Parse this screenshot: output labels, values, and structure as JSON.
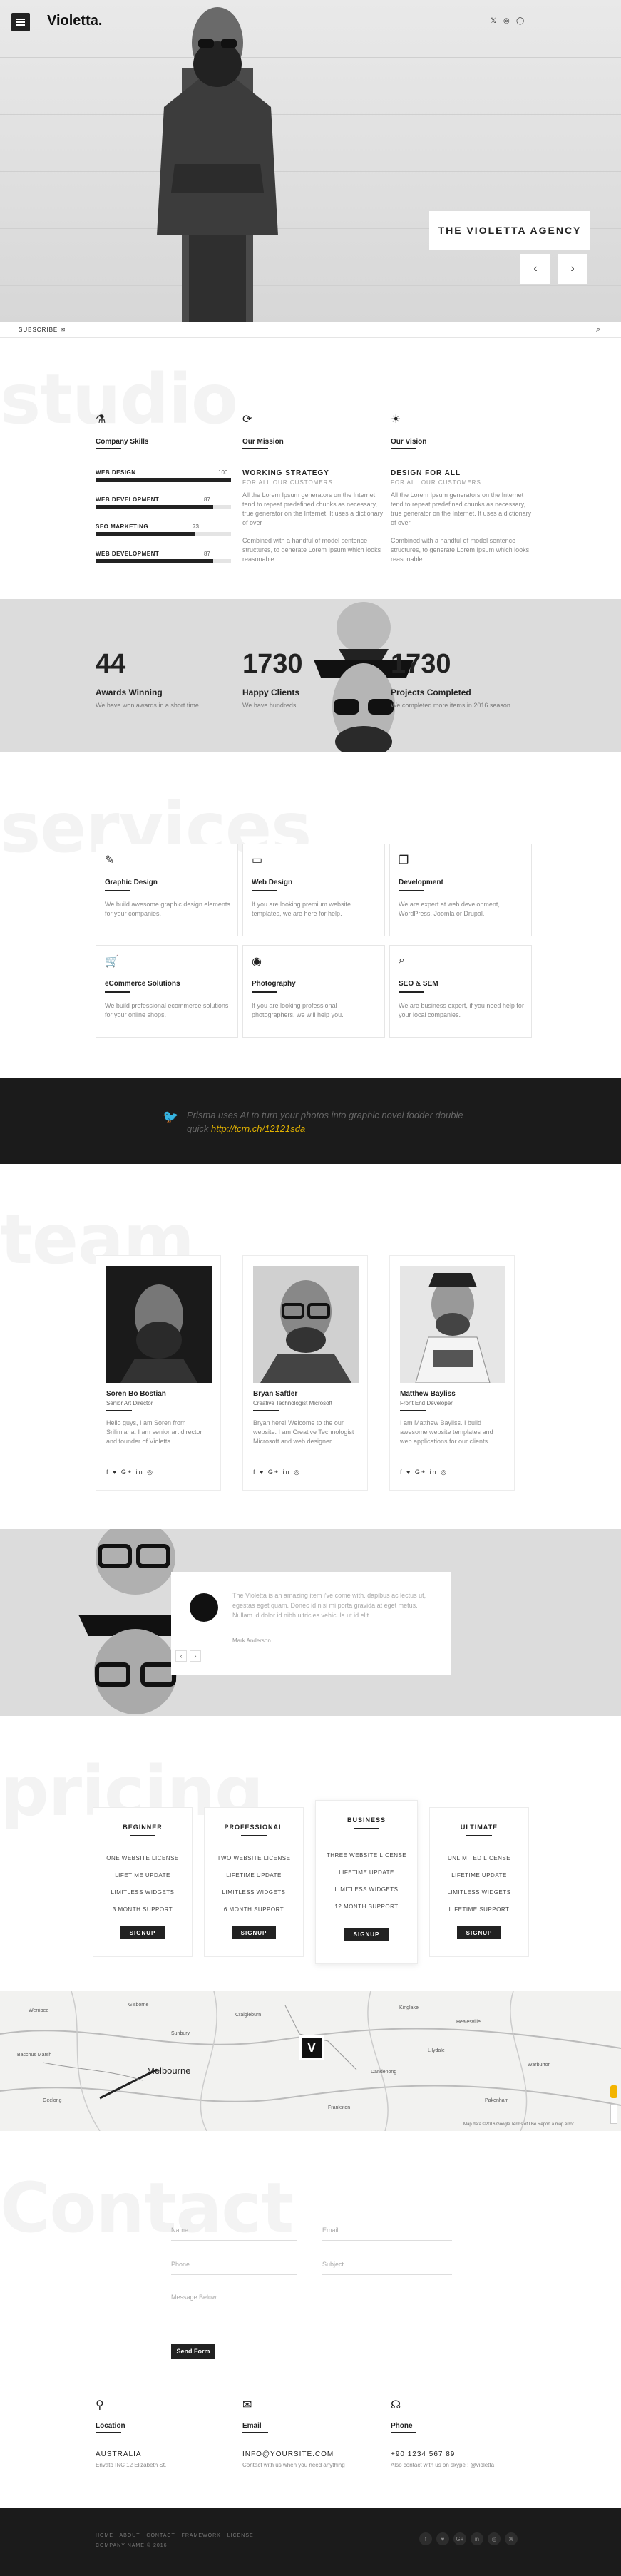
{
  "header": {
    "logo": "Violetta.",
    "social": [
      "𝕏",
      "◎",
      "◯"
    ]
  },
  "hero": {
    "agency": "THE VIOLETTA AGENCY",
    "prev": "‹",
    "next": "›"
  },
  "subscribe": {
    "label": "SUBSCRIBE ✉",
    "search_icon": "search-icon"
  },
  "studio": {
    "watermark": "studio",
    "skills": {
      "title": "Company Skills",
      "items": [
        {
          "label": "WEB DESIGN",
          "value": "100",
          "level": 1.0
        },
        {
          "label": "WEB DEVELOPMENT",
          "value": "87",
          "level": 0.87
        },
        {
          "label": "SEO MARKETING",
          "value": "73",
          "level": 0.73
        },
        {
          "label": "WEB DEVELOPMENT",
          "value": "87",
          "level": 0.87
        }
      ]
    },
    "mission": {
      "title": "Our Mission",
      "subtitle": "WORKING STRATEGY",
      "subtitle2": "FOR ALL OUR CUSTOMERS",
      "text1": "All the Lorem Ipsum generators on the Internet tend to repeat predefined chunks as necessary, true generator on the Internet. It uses a dictionary of over",
      "text2": "Combined with a handful of model sentence structures, to generate Lorem Ipsum which looks reasonable."
    },
    "vision": {
      "title": "Our Vision",
      "subtitle": "DESIGN FOR ALL",
      "subtitle2": "FOR ALL OUR CUSTOMERS",
      "text1": "All the Lorem Ipsum generators on the Internet tend to repeat predefined chunks as necessary, true generator on the Internet. It uses a dictionary of over",
      "text2": "Combined with a handful of model sentence structures, to generate Lorem Ipsum which looks reasonable."
    }
  },
  "stats": [
    {
      "num": "44",
      "label": "Awards Winning",
      "text": "We have won awards in a short time"
    },
    {
      "num": "1730",
      "label": "Happy Clients",
      "text": "We have hundreds"
    },
    {
      "num": "1730",
      "label": "Projects Completed",
      "text": "We completed more items in 2016 season"
    }
  ],
  "services": {
    "watermark": "services",
    "items": [
      {
        "icon": "✎",
        "title": "Graphic Design",
        "text": "We build awesome graphic design elements for your companies."
      },
      {
        "icon": "▭",
        "title": "Web Design",
        "text": "If you are looking premium website templates, we are here for help."
      },
      {
        "icon": "❐",
        "title": "Development",
        "text": "We are expert at web development, WordPress, Joomla or Drupal."
      },
      {
        "icon": "🛒",
        "title": "eCommerce Solutions",
        "text": "We build professional ecommerce solutions for your online shops."
      },
      {
        "icon": "◉",
        "title": "Photography",
        "text": "If you are looking professional photographers, we will help you."
      },
      {
        "icon": "⌕",
        "title": "SEO & SEM",
        "text": "We are business expert, if you need help for your local companies."
      }
    ]
  },
  "tweet": {
    "text": "Prisma uses AI to turn your photos into graphic novel fodder double quick",
    "link": "http://tcrn.ch/12121sda"
  },
  "team": {
    "watermark": "team",
    "members": [
      {
        "name": "Soren Bo Bostian",
        "role": "Senior Art Director",
        "bio": "Hello guys, I am Soren from Srilimiana. I am senior art director and founder of Violetta.",
        "social": "f ♥ G+ in ◎"
      },
      {
        "name": "Bryan Saftler",
        "role": "Creative Technologist Microsoft",
        "bio": "Bryan here! Welcome to the our website. I am Creative Technologist Microsoft and web designer.",
        "social": "f ♥ G+ in ◎"
      },
      {
        "name": "Matthew Bayliss",
        "role": "Front End Developer",
        "bio": "I am Matthew Bayliss. I build awesome website templates and web applications for our clients.",
        "social": "f ♥ G+ in ◎"
      }
    ]
  },
  "testimonial": {
    "text": "The Violetta is an amazing item i've come with. dapibus ac lectus ut, egestas eget quam. Donec id nisi mi porta gravida at eget metus. Nullam id dolor id nibh ultricies vehicula ut id elit.",
    "author": "Mark Anderson",
    "prev": "‹",
    "next": "›"
  },
  "pricing": {
    "watermark": "pricing",
    "plans": [
      {
        "title": "BEGINNER",
        "items": [
          "ONE WEBSITE LICENSE",
          "LIFETIME UPDATE",
          "LIMITLESS WIDGETS",
          "3 MONTH SUPPORT"
        ],
        "button": "SIGNUP"
      },
      {
        "title": "PROFESSIONAL",
        "items": [
          "TWO WEBSITE LICENSE",
          "LIFETIME UPDATE",
          "LIMITLESS WIDGETS",
          "6 MONTH SUPPORT"
        ],
        "button": "SIGNUP"
      },
      {
        "title": "BUSINESS",
        "items": [
          "THREE WEBSITE LICENSE",
          "LIFETIME UPDATE",
          "LIMITLESS WIDGETS",
          "12 MONTH SUPPORT"
        ],
        "button": "SIGNUP"
      },
      {
        "title": "ULTIMATE",
        "items": [
          "UNLIMITED LICENSE",
          "LIFETIME UPDATE",
          "LIMITLESS WIDGETS",
          "LIFETIME SUPPORT"
        ],
        "button": "SIGNUP"
      }
    ]
  },
  "map": {
    "city": "Melbourne",
    "marker": "V",
    "credits": "Map data ©2016 Google   Terms of Use   Report a map error",
    "places": [
      "Werribee",
      "Gisborne",
      "Bacchus Marsh",
      "Sunbury",
      "Craigieburn",
      "Healesville",
      "Dandenong",
      "Frankston",
      "Geelong",
      "Lilydale",
      "Warburton",
      "Pakenham",
      "Kinglake"
    ]
  },
  "contact": {
    "watermark": "Contact",
    "name_ph": "Name",
    "email_ph": "Email",
    "phone_ph": "Phone",
    "subject_ph": "Subject",
    "message_ph": "Message Below",
    "send": "Send Form",
    "cols": [
      {
        "icon": "⚲",
        "title": "Location",
        "value": "AUSTRALIA",
        "sub": "Envato INC 12 Elizabeth St."
      },
      {
        "icon": "✉",
        "title": "Email",
        "value": "INFO@YOURSITE.COM",
        "sub": "Contact with us when you need anything"
      },
      {
        "icon": "☊",
        "title": "Phone",
        "value": "+90 1234 567 89",
        "sub": "Also contact with us on skype : @violetta"
      }
    ]
  },
  "footer": {
    "links": [
      "HOME",
      "ABOUT",
      "CONTACT",
      "FRAMEWORK",
      "LICENSE"
    ],
    "copyright": "COMPANY NAME © 2016",
    "social": [
      "f",
      "♥",
      "G+",
      "in",
      "◎",
      "⌘"
    ]
  }
}
